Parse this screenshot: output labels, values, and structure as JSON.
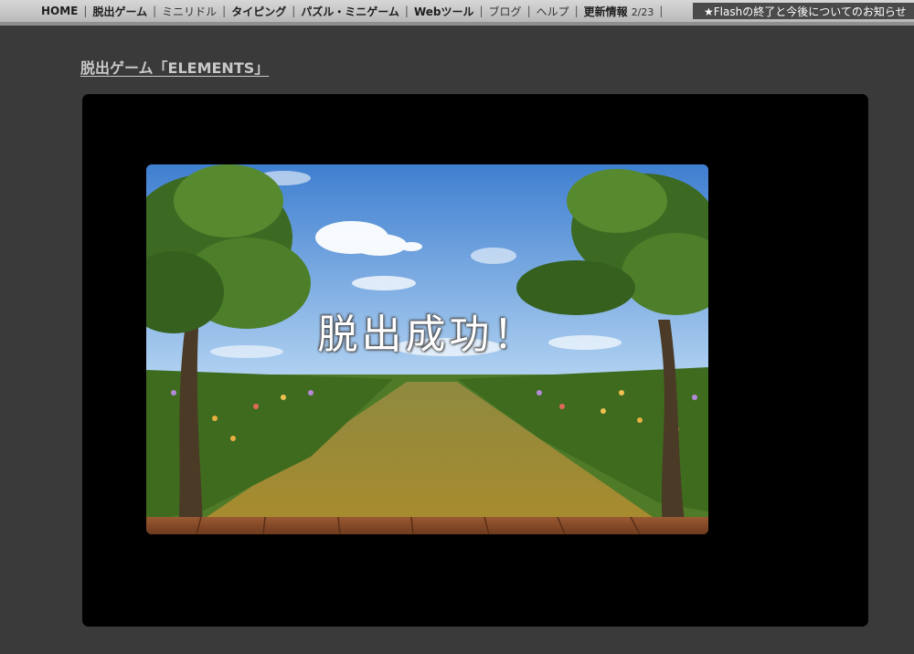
{
  "nav": {
    "items": [
      {
        "label": "HOME"
      },
      {
        "label": "脱出ゲーム"
      },
      {
        "label": "ミニリドル"
      },
      {
        "label": "タイピング"
      },
      {
        "label": "パズル・ミニゲーム"
      },
      {
        "label": "Webツール"
      },
      {
        "label": "ブログ"
      },
      {
        "label": "ヘルプ"
      },
      {
        "label": "更新情報"
      }
    ],
    "update_date": "2/23",
    "notice": "★Flashの終了と今後についてのお知らせ"
  },
  "page": {
    "title": "脱出ゲーム「ELEMENTS」"
  },
  "game": {
    "message": "脱出成功！",
    "colors": {
      "sky_top": "#3f7fd0",
      "sky_bottom": "#a9cdf0",
      "grass": "#5e8a2c",
      "path": "#9a8a3a",
      "floor": "#8a4e2c"
    }
  }
}
